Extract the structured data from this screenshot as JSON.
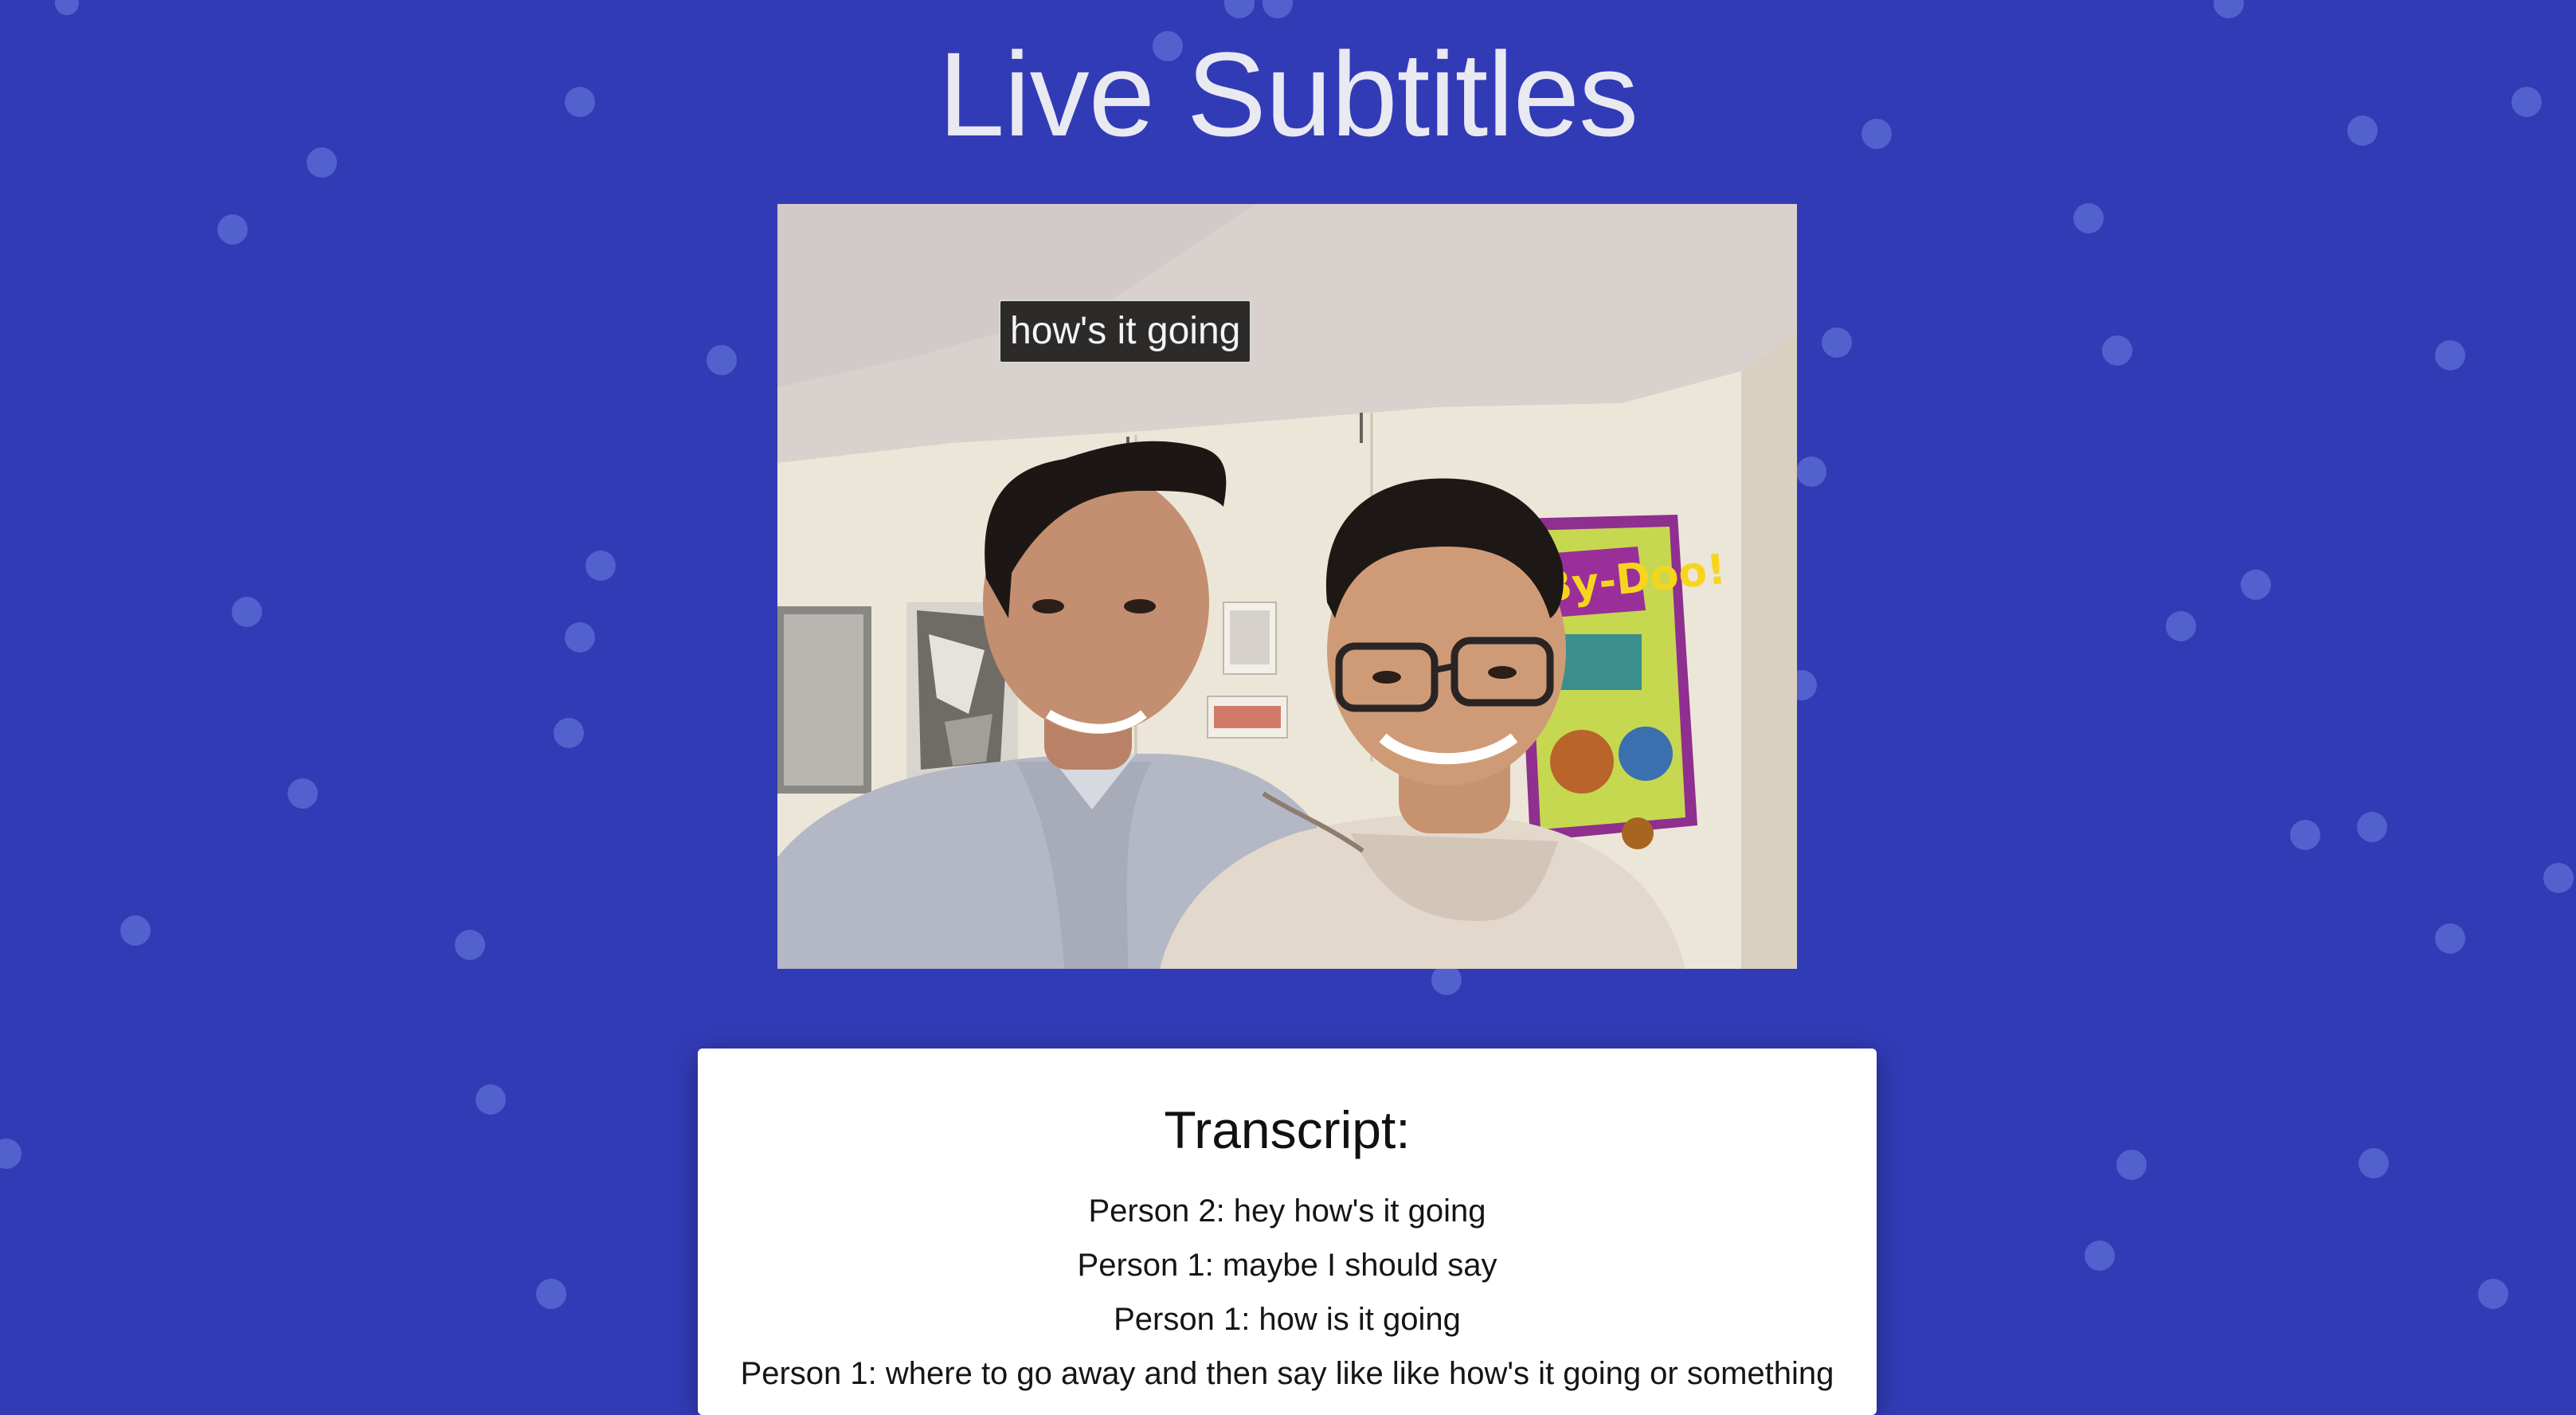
{
  "page": {
    "title": "Live Subtitles",
    "background_color": "#323bb6"
  },
  "video": {
    "subtitle_text": "how's it going",
    "poster_text": "By-Doo!"
  },
  "transcript": {
    "heading": "Transcript:",
    "lines": [
      "Person 2: hey how's it going",
      "Person 1: maybe I should say",
      "Person 1: how is it going",
      "Person 1: where to go away and then say like like how's it going or something"
    ]
  }
}
